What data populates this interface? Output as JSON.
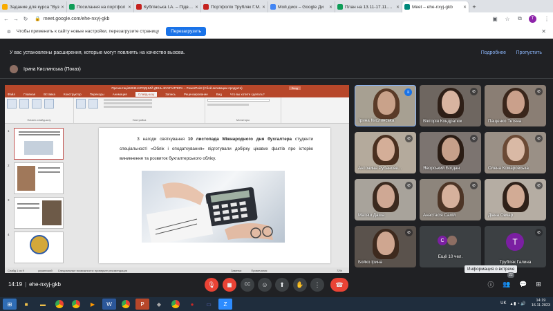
{
  "browser": {
    "tabs": [
      {
        "label": "Задание для курса \"Вуз",
        "color": "#f9ab00"
      },
      {
        "label": "Посилання на портфол",
        "color": "#0f9d58"
      },
      {
        "label": "Кублінська І.А. – Підвиш",
        "color": "#c5221f"
      },
      {
        "label": "Портфоліо Трубляк Г.М.",
        "color": "#c5221f"
      },
      {
        "label": "Мой диск – Google Ди",
        "color": "#4285f4"
      },
      {
        "label": "План на 13.11-17.11.202",
        "color": "#0f9d58"
      },
      {
        "label": "Meet – ehe-nxyj-gkb",
        "color": "#00897b",
        "active": true
      }
    ],
    "url": "meet.google.com/ehe-nxyj-gkb",
    "infobar_text": "Чтобы применить к сайту новые настройки, перезагрузите страницу",
    "reload_label": "Перезагрузить",
    "avatar_letter": "T"
  },
  "meet": {
    "extension_warning": "У вас установлены расширения, которые могут повлиять на качество вызова.",
    "details_label": "Подробнее",
    "skip_label": "Пропустить",
    "presenter": "Ірина Кислинська (Показ)",
    "meeting_time": "14:19",
    "meeting_code": "ehe-nxyj-gkb",
    "tooltip": "Информация о встрече",
    "participants_count": "22"
  },
  "ppt": {
    "title_bar": "ПрезентаціяМІЖНАРОДНИЙ ДЕНЬ БУХГАЛТЕРА – PowerPoint (Сбой активации продукта)",
    "menu": [
      "Файл",
      "Главная",
      "Вставка",
      "Конструктор",
      "Переходы",
      "Анимация",
      "Слайд-шоу",
      "Запись",
      "Рецензирование",
      "Вид",
      "Что вы хотите сделать?"
    ],
    "active_menu": "Слайд-шоу",
    "ribbon_groups": [
      "Начать слайд-шоу",
      "Настройка",
      "Мониторы"
    ],
    "slide_text_1": "З нагоди святкування ",
    "slide_bold_1": "10 листопада Міжнародного дня бухгалтера",
    "slide_text_2": " студенти спеціальності «Облік і оподаткування» підготували добірку цікавих фактів про історію виникнення та розвиток бухгалтерського обліку.",
    "status_left": "Слайд 1 из 9",
    "status_lang": "украинский",
    "status_access": "Специальные возможности: проверьте рекомендации",
    "status_notes": "Заметки",
    "status_comments": "Примечания",
    "zoom": "72%",
    "slide_numbers": [
      "1",
      "2",
      "3",
      "4"
    ]
  },
  "participants": [
    {
      "name": "Ірина Кислинська",
      "muted": false
    },
    {
      "name": "Вікторія Кондратюк",
      "muted": true
    },
    {
      "name": "Пащенко Тетяна",
      "muted": true
    },
    {
      "name": "Антонина Рубанове...",
      "muted": true
    },
    {
      "name": "Яворський Богдан",
      "muted": true
    },
    {
      "name": "Олена Комаровська",
      "muted": true
    },
    {
      "name": "Матяш Даша",
      "muted": true
    },
    {
      "name": "Анастасія Салій",
      "muted": true
    },
    {
      "name": "Діана Овчар",
      "muted": true
    },
    {
      "name": "Бойко Ірина",
      "muted": true
    },
    {
      "name": "Ещё 10 чел.",
      "muted": false
    },
    {
      "name": "Трубляк Галина",
      "muted": true
    }
  ],
  "taskbar": {
    "lang": "UK",
    "time": "14:19",
    "date": "16.11.2023"
  }
}
